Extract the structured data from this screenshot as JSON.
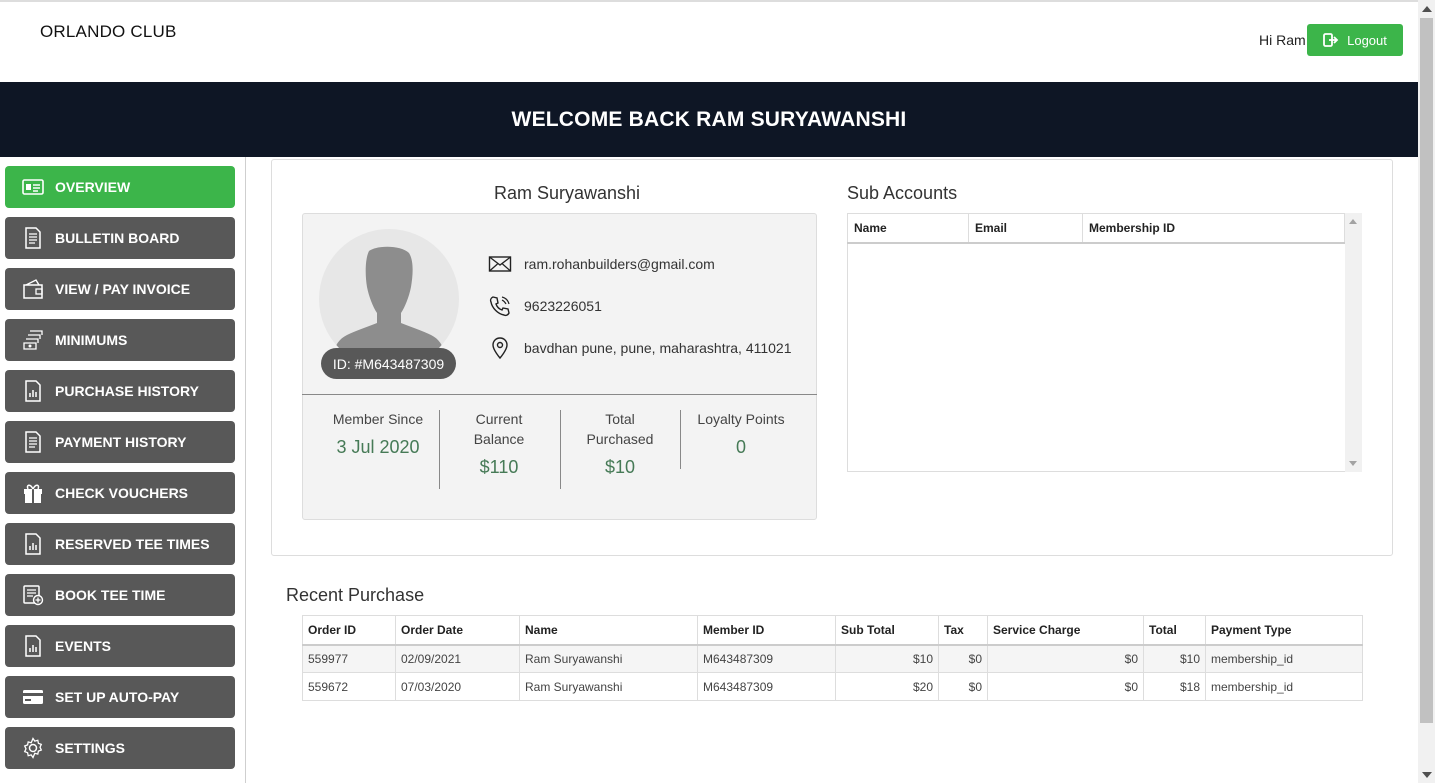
{
  "header": {
    "brand": "ORLANDO CLUB",
    "greeting": "Hi Ram",
    "logout_label": "Logout",
    "accent_color": "#3cb54a"
  },
  "banner": {
    "title": "WELCOME BACK RAM SURYAWANSHI",
    "background": "#0e1625"
  },
  "sidebar": {
    "items": [
      {
        "label": "OVERVIEW",
        "icon": "id-card-icon",
        "active": true
      },
      {
        "label": "BULLETIN BOARD",
        "icon": "document-list-icon"
      },
      {
        "label": "VIEW / PAY INVOICE",
        "icon": "wallet-icon"
      },
      {
        "label": "MINIMUMS",
        "icon": "money-stack-icon"
      },
      {
        "label": "PURCHASE HISTORY",
        "icon": "report-chart-icon"
      },
      {
        "label": "PAYMENT HISTORY",
        "icon": "document-list-icon"
      },
      {
        "label": "CHECK VOUCHERS",
        "icon": "gift-icon"
      },
      {
        "label": "RESERVED TEE TIMES",
        "icon": "report-chart-icon"
      },
      {
        "label": "BOOK TEE TIME",
        "icon": "list-add-icon"
      },
      {
        "label": "EVENTS",
        "icon": "report-chart-icon"
      },
      {
        "label": "SET UP AUTO-PAY",
        "icon": "credit-card-icon"
      },
      {
        "label": "SETTINGS",
        "icon": "gear-icon"
      }
    ]
  },
  "profile": {
    "name": "Ram Suryawanshi",
    "member_id_label": "ID: #M643487309",
    "email": "ram.rohanbuilders@gmail.com",
    "phone": "9623226051",
    "address": "bavdhan pune, pune, maharashtra, 411021",
    "stats": [
      {
        "label_line1": "Member Since",
        "label_line2": "",
        "value": "3 Jul 2020"
      },
      {
        "label_line1": "Current",
        "label_line2": "Balance",
        "value": "$110"
      },
      {
        "label_line1": "Total",
        "label_line2": "Purchased",
        "value": "$10"
      },
      {
        "label_line1": "Loyalty Points",
        "label_line2": "",
        "value": "0"
      }
    ]
  },
  "sub_accounts": {
    "title": "Sub Accounts",
    "columns": [
      "Name",
      "Email",
      "Membership ID"
    ]
  },
  "recent_purchase": {
    "title": "Recent Purchase",
    "columns": [
      "Order ID",
      "Order Date",
      "Name",
      "Member ID",
      "Sub Total",
      "Tax",
      "Service Charge",
      "Total",
      "Payment Type"
    ],
    "rows": [
      [
        "559977",
        "02/09/2021",
        "Ram Suryawanshi",
        "M643487309",
        "$10",
        "$0",
        "$0",
        "$10",
        "membership_id"
      ],
      [
        "559672",
        "07/03/2020",
        "Ram Suryawanshi",
        "M643487309",
        "$20",
        "$0",
        "$0",
        "$18",
        "membership_id"
      ]
    ]
  }
}
